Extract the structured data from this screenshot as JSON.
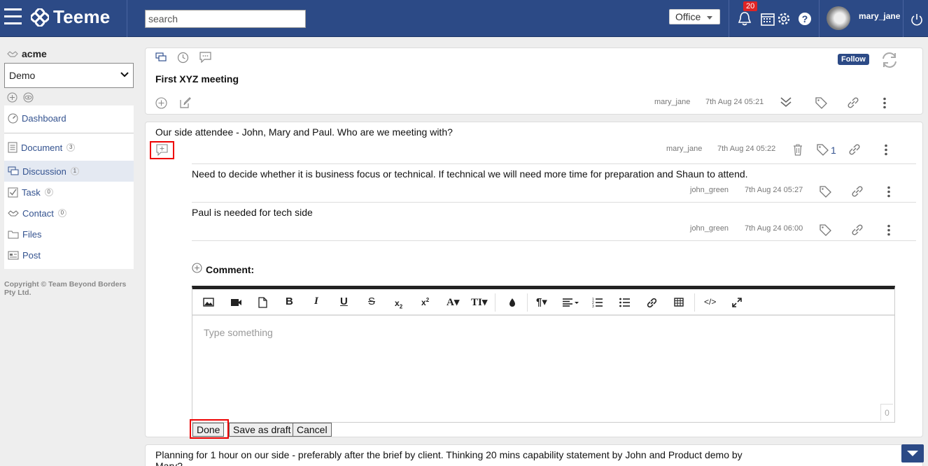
{
  "app": {
    "name": "Teeme",
    "notification_count": "20",
    "username": "mary_jane"
  },
  "search": {
    "placeholder": "search",
    "value": ""
  },
  "header": {
    "office_label": "Office"
  },
  "sidebar": {
    "org": "acme",
    "space": "Demo",
    "items": [
      {
        "label": "Dashboard",
        "count": ""
      },
      {
        "label": "Document",
        "count": "3"
      },
      {
        "label": "Discussion",
        "count": "1"
      },
      {
        "label": "Task",
        "count": "0"
      },
      {
        "label": "Contact",
        "count": "0"
      },
      {
        "label": "Files",
        "count": ""
      },
      {
        "label": "Post",
        "count": ""
      }
    ],
    "copyright": "Copyright © Team Beyond Borders Pty Ltd."
  },
  "topic": {
    "title": "First XYZ meeting",
    "follow_label": "Follow",
    "author": "mary_jane",
    "time": "7th Aug 24 05:21"
  },
  "post": {
    "text": "Our side attendee - John, Mary and Paul. Who are we meeting with?",
    "author": "mary_jane",
    "time": "7th Aug 24 05:22",
    "tag_count": "1",
    "replies": [
      {
        "text": "Need to decide whether it is business focus or technical. If technical we will need more time for preparation and Shaun to attend.",
        "author": "john_green",
        "time": "7th Aug 24 05:27"
      },
      {
        "text": "Paul is needed for tech side",
        "author": "john_green",
        "time": "7th Aug 24 06:00"
      }
    ]
  },
  "comment": {
    "label": "Comment:",
    "placeholder": "Type something",
    "char_count": "0",
    "done_label": "Done",
    "draft_label": "Save as draft",
    "cancel_label": "Cancel"
  },
  "next_post": {
    "text": "Planning for 1 hour on our side - preferably after the brief by client. Thinking 20 mins capability statement by John and Product demo by Mary?"
  },
  "colors": {
    "header": "#2c4a86",
    "highlight": "#ee0000",
    "link": "#33528f"
  }
}
